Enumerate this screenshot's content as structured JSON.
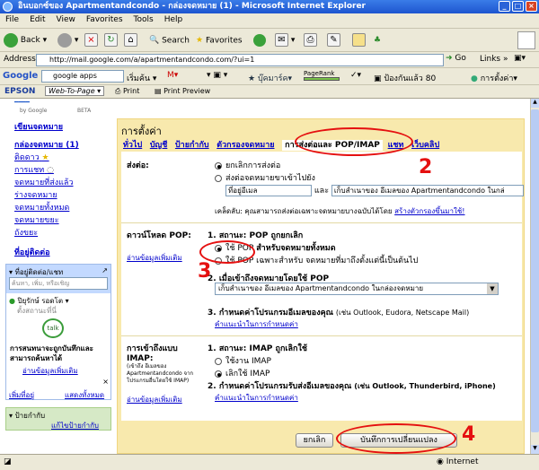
{
  "window": {
    "title": "อินบอกซ์ของ Apartmentandcondo - กล่องจดหมาย (1) - Microsoft Internet Explorer"
  },
  "menu": [
    "File",
    "Edit",
    "View",
    "Favorites",
    "Tools",
    "Help"
  ],
  "toolbar": {
    "back": "Back",
    "search": "Search",
    "favorites": "Favorites"
  },
  "address": {
    "label": "Address",
    "url": "http://mail.google.com/a/apartmentandcondo.com/?ui=1",
    "go": "Go",
    "links": "Links"
  },
  "googlebar": {
    "query": "google apps",
    "search_btn": "เริ่มค้น",
    "bookmarks": "บุ๊คมาร์ค",
    "pagerank": "PageRank",
    "blocked": "ป้องกันแล้ว 80",
    "settings": "การตั้งค่า"
  },
  "epsonbar": {
    "brand": "EPSON",
    "web_to_page": "Web-To-Page",
    "print": "Print",
    "print_preview": "Print Preview"
  },
  "logo": {
    "by": "by Google",
    "beta": "BETA"
  },
  "leftnav": {
    "compose": "เขียนจดหมาย",
    "items": [
      "กล่องจดหมาย (1)",
      "ติดดาว",
      "การแชท",
      "จดหมายที่ส่งแล้ว",
      "ร่างจดหมาย",
      "จดหมายทั้งหมด",
      "จดหมายขยะ",
      "ถังขยะ"
    ],
    "contacts": "ที่อยู่ติดต่อ",
    "chat_header": "ที่อยู่ติดต่อ/แชท",
    "chat_search_placeholder": "ค้นหา, เพิ่ม, หรือเชิญ",
    "user_name": "ปิยุรักษ์ รอดโต",
    "user_status": "ตั้งสถานะที่นี่",
    "talk_msg": "การสนทนาจะถูกบันทึกและสามารถค้นหาได้",
    "talk_link": "อ่านข้อมูลเพิ่มเติม",
    "add_contact": "เพิ่มที่อยู่",
    "show_all": "แสดงทั้งหมด",
    "labels_header": "ป้ายกำกับ",
    "edit_labels": "แก้ไขป้ายกำกับ"
  },
  "settings": {
    "title": "การตั้งค่า",
    "tabs": [
      "ทั่วไป",
      "บัญชี",
      "ป้ายกำกับ",
      "ตัวกรองจดหมาย",
      "การส่งต่อและ POP/IMAP",
      "แชท",
      "เว็บคลิป"
    ],
    "forwarding": {
      "label": "ส่งต่อ:",
      "opt1": "ยกเลิกการส่งต่อ",
      "opt2": "ส่งต่อจดหมายขาเข้าไปยัง",
      "email_field": "ที่อยู่อีเมล",
      "and": "และ",
      "keep_select": "เก็บสำเนาของ อีเมลของ Apartmentandcondo ในกล่",
      "tip": "เคล็ดลับ: คุณสามารถส่งต่อเฉพาะจดหมายบางฉบับได้โดย",
      "tip_link": "สร้างตัวกรองขึ้นมาใช้!"
    },
    "pop": {
      "label": "ดาวน์โหลด POP:",
      "learn": "อ่านข้อมูลเพิ่มเติม",
      "status": "1. สถานะ: POP ถูกยกเลิก",
      "opt1_a": "ใช้ POP",
      "opt1_b": "สำหรับจดหมายทั้งหมด",
      "opt2": "ใช้ POP เฉพาะสำหรับ จดหมายที่มาถึงตั้งแต่นี้เป็นต้นไป",
      "q2": "2. เมื่อเข้าถึงจดหมายโดยใช้ POP",
      "q2_select": "เก็บสำเนาของ อีเมลของ Apartmentandcondo ในกล่องจดหมาย",
      "q3": "3. กำหนดค่าโปรแกรมอีเมลของคุณ",
      "q3_suffix": "(เช่น Outlook, Eudora, Netscape Mail)",
      "q3_link": "คำแนะนำในการกำหนดค่า"
    },
    "imap": {
      "label": "การเข้าถึงแบบ IMAP:",
      "sub": "(เข้าถึง อีเมลของ Apartmentandcondo จากโปรแกรมอื่นโดยใช้ IMAP)",
      "learn": "อ่านข้อมูลเพิ่มเติม",
      "status": "1. สถานะ: IMAP ถูกเลิกใช้",
      "opt1": "ใช้งาน IMAP",
      "opt2": "เลิกใช้ IMAP",
      "q2": "2. กำหนดค่าโปรแกรมรับส่งอีเมลของคุณ",
      "q2_suffix": "(เช่น Outlook, Thunderbird, iPhone)",
      "q2_link": "คำแนะนำในการกำหนดค่า"
    },
    "cancel_btn": "ยกเลิก",
    "save_btn": "บันทึกการเปลี่ยนแปลง"
  },
  "annotations": {
    "n2": "2",
    "n3": "3",
    "n4": "4"
  },
  "status": {
    "zone": "Internet"
  },
  "colors": {
    "settings_bg": "#f8e9ad",
    "annotation": "#e51010",
    "link": "#0000cc"
  }
}
